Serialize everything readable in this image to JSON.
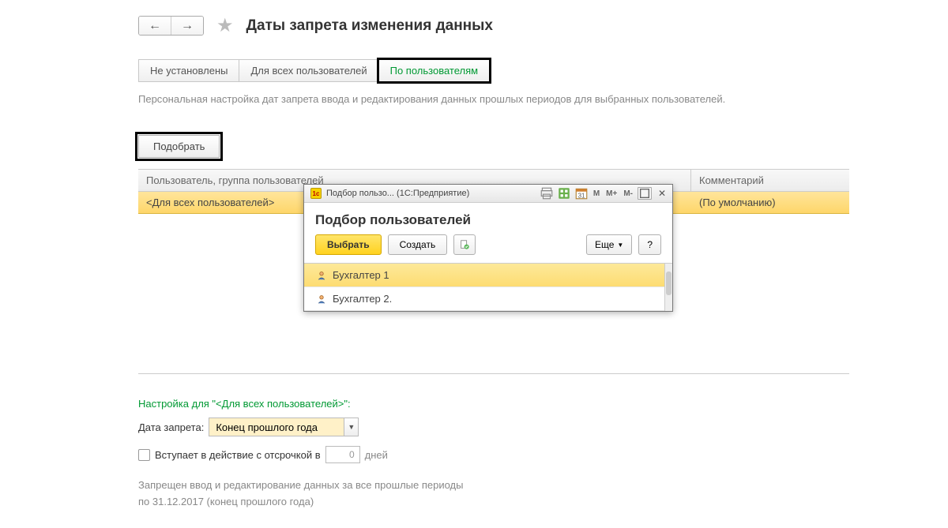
{
  "header": {
    "title": "Даты запрета изменения данных"
  },
  "tabs": {
    "t0": "Не установлены",
    "t1": "Для всех пользователей",
    "t2": "По пользователям"
  },
  "description": "Персональная настройка дат запрета ввода и редактирования данных прошлых периодов для выбранных пользователей.",
  "toolbar": {
    "select_label": "Подобрать"
  },
  "grid": {
    "col_user": "Пользователь, группа пользователей",
    "col_comment": "Комментарий",
    "row0_user": "<Для всех пользователей>",
    "row0_comment": "(По умолчанию)"
  },
  "modal": {
    "titlebar": "Подбор пользо... (1С:Предприятие)",
    "m_label": "M",
    "mplus_label": "M+",
    "mminus_label": "M-",
    "title": "Подбор пользователей",
    "choose": "Выбрать",
    "create": "Создать",
    "more": "Еще",
    "help": "?",
    "item0": "Бухгалтер 1",
    "item1": "Бухгалтер 2."
  },
  "settings": {
    "title": "Настройка для \"<Для всех пользователей>\":",
    "date_label": "Дата запрета:",
    "date_value": "Конец прошлого года",
    "delay_label": "Вступает в действие с отсрочкой в",
    "delay_value": "0",
    "delay_unit": "дней",
    "footer_line1": "Запрещен ввод и редактирование данных за все прошлые периоды",
    "footer_line2": "по 31.12.2017 (конец прошлого года)"
  }
}
